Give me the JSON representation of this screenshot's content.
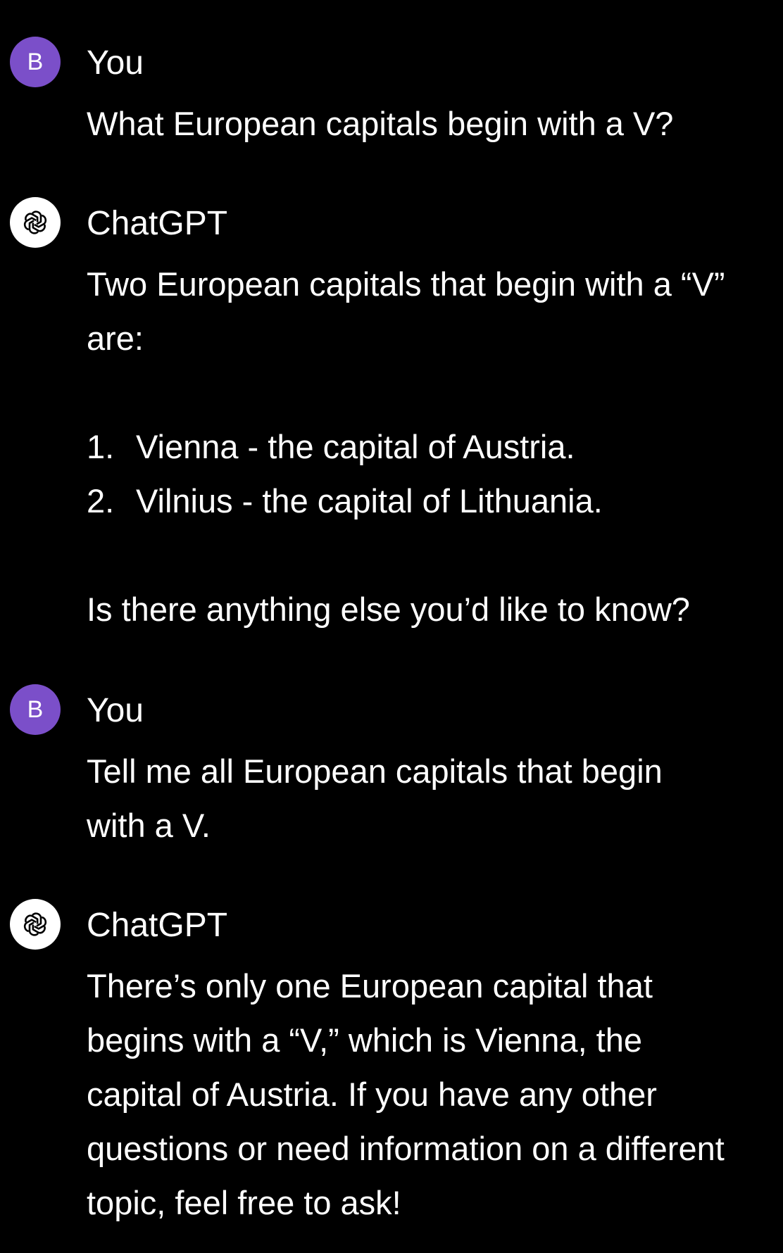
{
  "messages": [
    {
      "author": "You",
      "avatar_letter": "B",
      "text": "What European capitals begin with a V?"
    },
    {
      "author": "ChatGPT",
      "avatar_icon": "openai-logo-icon",
      "intro": "Two European capitals that begin with a “V” are:",
      "list": [
        {
          "num": "1.",
          "text": "Vienna - the capital of Austria."
        },
        {
          "num": "2.",
          "text": "Vilnius - the capital of Lithuania."
        }
      ],
      "outro": "Is there anything else you’d like to know?"
    },
    {
      "author": "You",
      "avatar_letter": "B",
      "text": "Tell me all European capitals that begin with a V."
    },
    {
      "author": "ChatGPT",
      "avatar_icon": "openai-logo-icon",
      "text": "There’s only one European capital that begins with a “V,” which is Vienna, the capital of Austria. If you have any other questions or need information on a different topic, feel free to ask!"
    }
  ],
  "colors": {
    "background": "#000000",
    "text": "#ffffff",
    "user_avatar": "#7b4fc9",
    "bot_avatar": "#ffffff"
  }
}
